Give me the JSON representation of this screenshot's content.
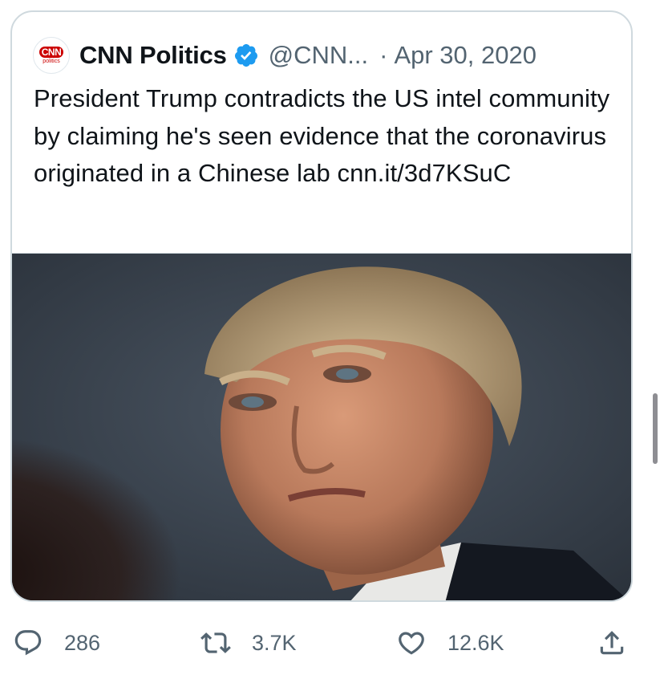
{
  "tweet": {
    "author_name": "CNN Politics",
    "handle": "@CNN...",
    "separator": "·",
    "date": "Apr 30, 2020",
    "text": "President Trump contradicts the US intel community by claiming he's seen evidence that the coronavirus originated in a Chinese lab cnn.it/3d7KSuC",
    "avatar": {
      "logo_text": "CNN",
      "sub_text": "politics"
    },
    "verified": true,
    "media_description": "photo"
  },
  "actions": {
    "reply_count": "286",
    "retweet_count": "3.7K",
    "like_count": "12.6K"
  },
  "colors": {
    "text": "#0f1419",
    "secondary": "#536471",
    "verified_blue": "#1d9bf0",
    "cnn_red": "#cc0000",
    "border": "#cfd9de"
  },
  "icons": [
    "reply-icon",
    "retweet-icon",
    "like-icon",
    "share-icon",
    "verified-badge-icon"
  ]
}
